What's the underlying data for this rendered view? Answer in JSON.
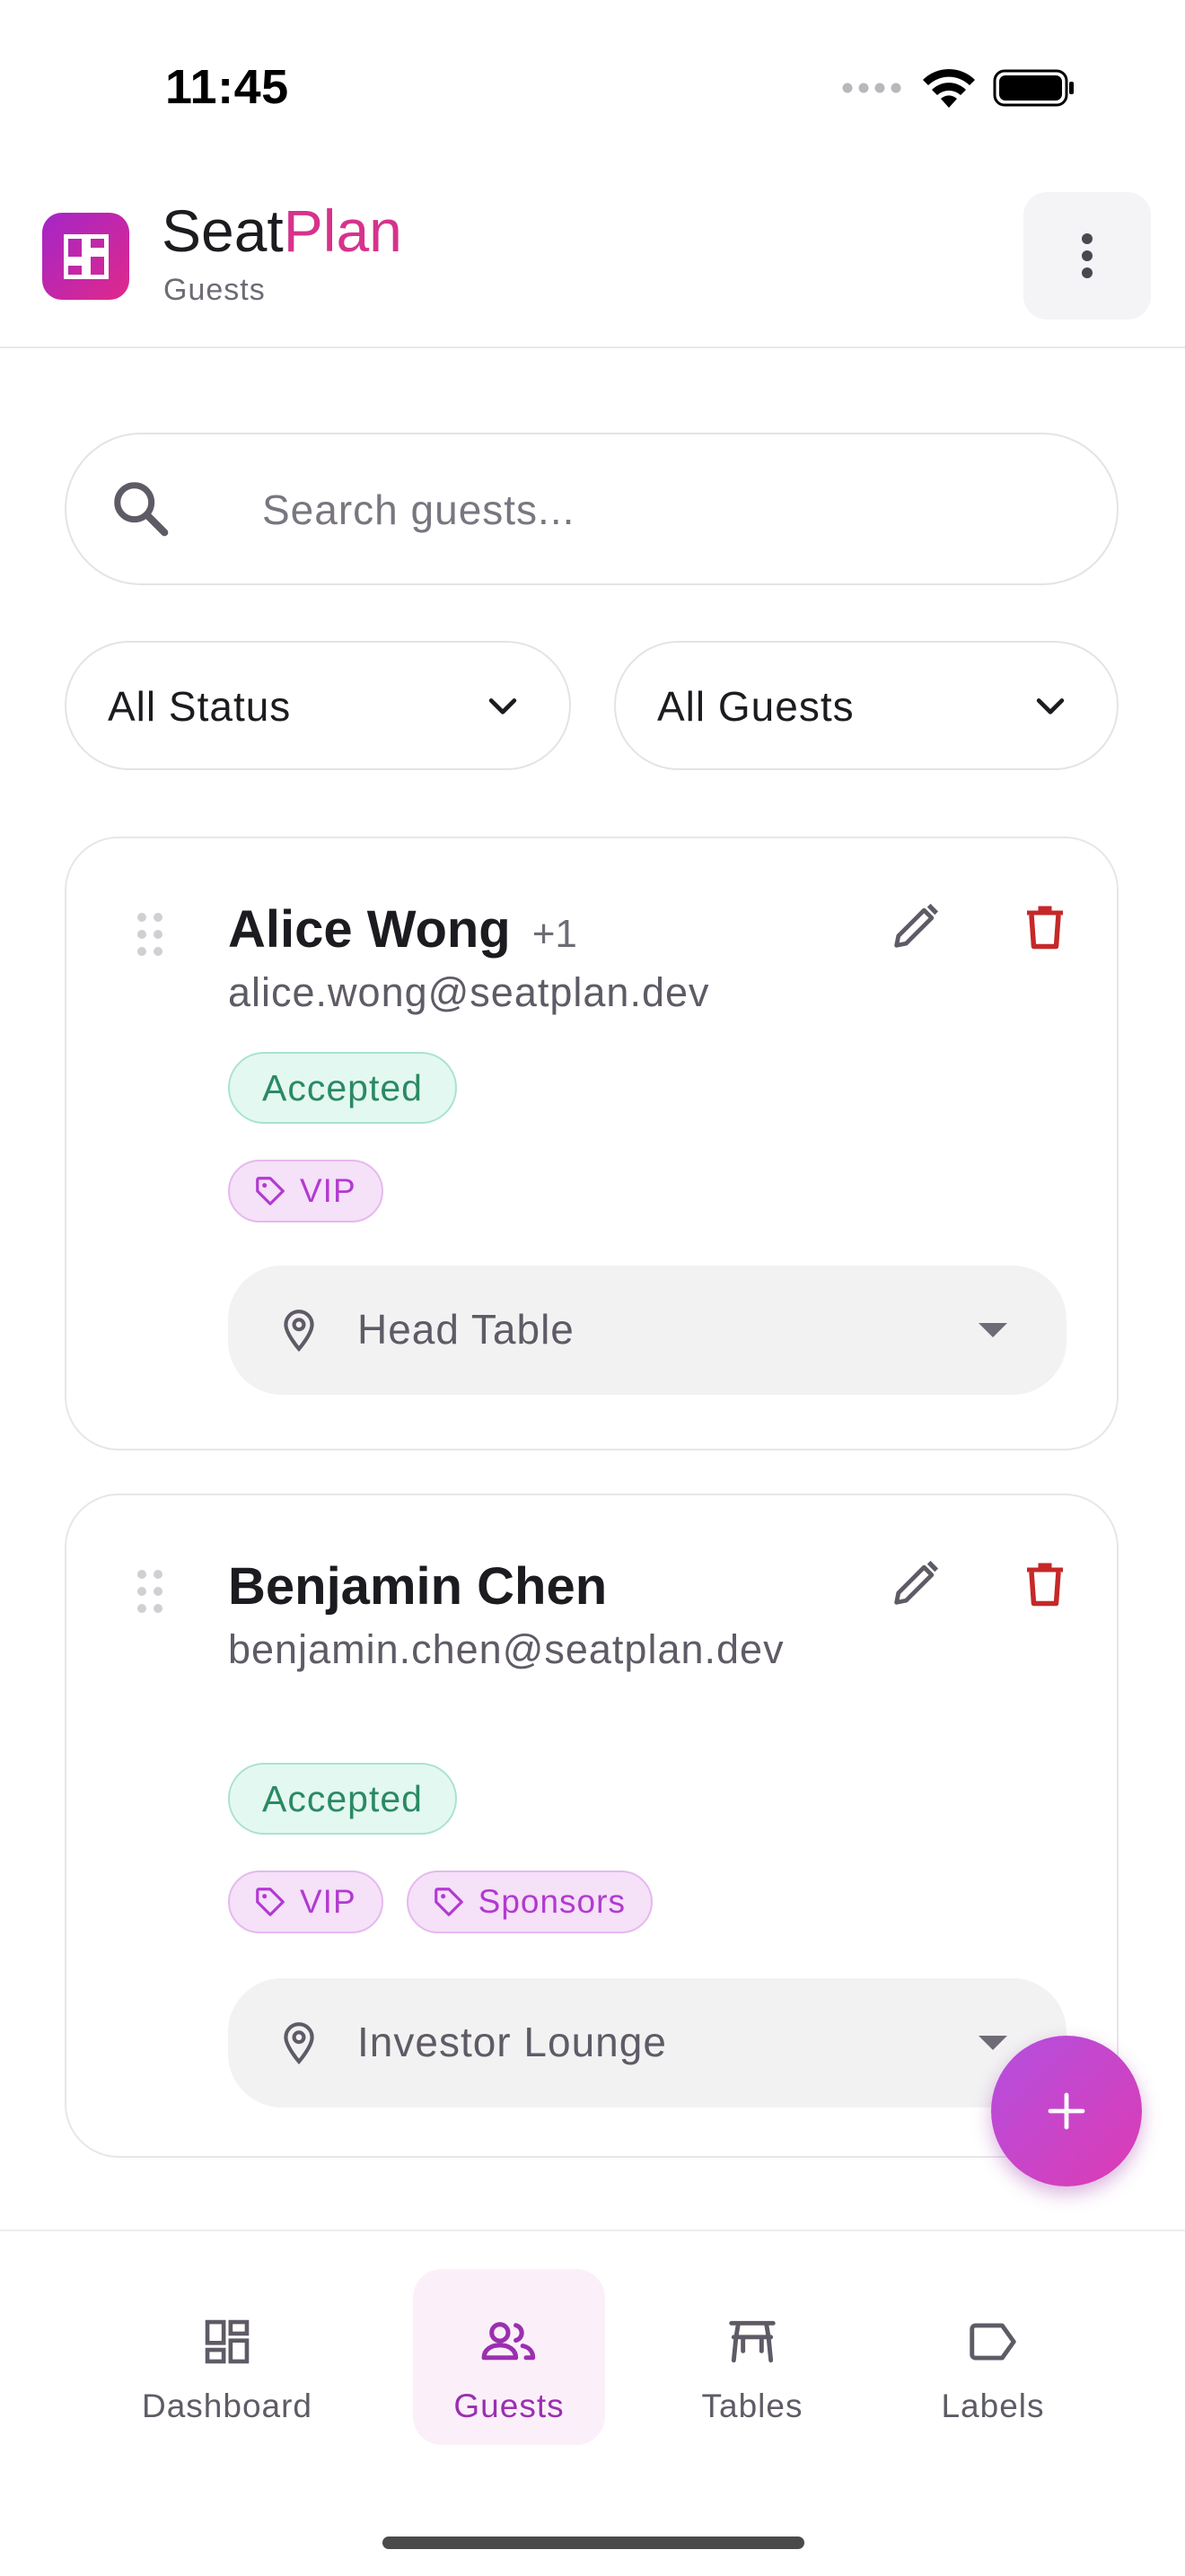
{
  "status_bar": {
    "time": "11:45"
  },
  "app_bar": {
    "title_part1": "Seat",
    "title_part2": "Plan",
    "subtitle": "Guests",
    "accent_color": "#d6338c"
  },
  "search": {
    "placeholder": "Search guests...",
    "value": ""
  },
  "filters": {
    "status": {
      "selected": "All Status"
    },
    "guests": {
      "selected": "All Guests"
    }
  },
  "guests": [
    {
      "name": "Alice Wong",
      "plus_one": "+1",
      "email": "alice.wong@seatplan.dev",
      "status": "Accepted",
      "tags": [
        "VIP"
      ],
      "table": "Head Table"
    },
    {
      "name": "Benjamin Chen",
      "plus_one": "",
      "email": "benjamin.chen@seatplan.dev",
      "status": "Accepted",
      "tags": [
        "VIP",
        "Sponsors"
      ],
      "table": "Investor Lounge"
    }
  ],
  "bottom_nav": {
    "items": [
      {
        "label": "Dashboard",
        "icon": "dashboard-icon",
        "active": false
      },
      {
        "label": "Guests",
        "icon": "people-icon",
        "active": true
      },
      {
        "label": "Tables",
        "icon": "table-icon",
        "active": false
      },
      {
        "label": "Labels",
        "icon": "label-icon",
        "active": false
      }
    ]
  },
  "colors": {
    "accepted_text": "#2a8a63",
    "tag_text": "#b23ad0",
    "delete_red": "#c62828",
    "active_nav": "#9b2fb0"
  }
}
